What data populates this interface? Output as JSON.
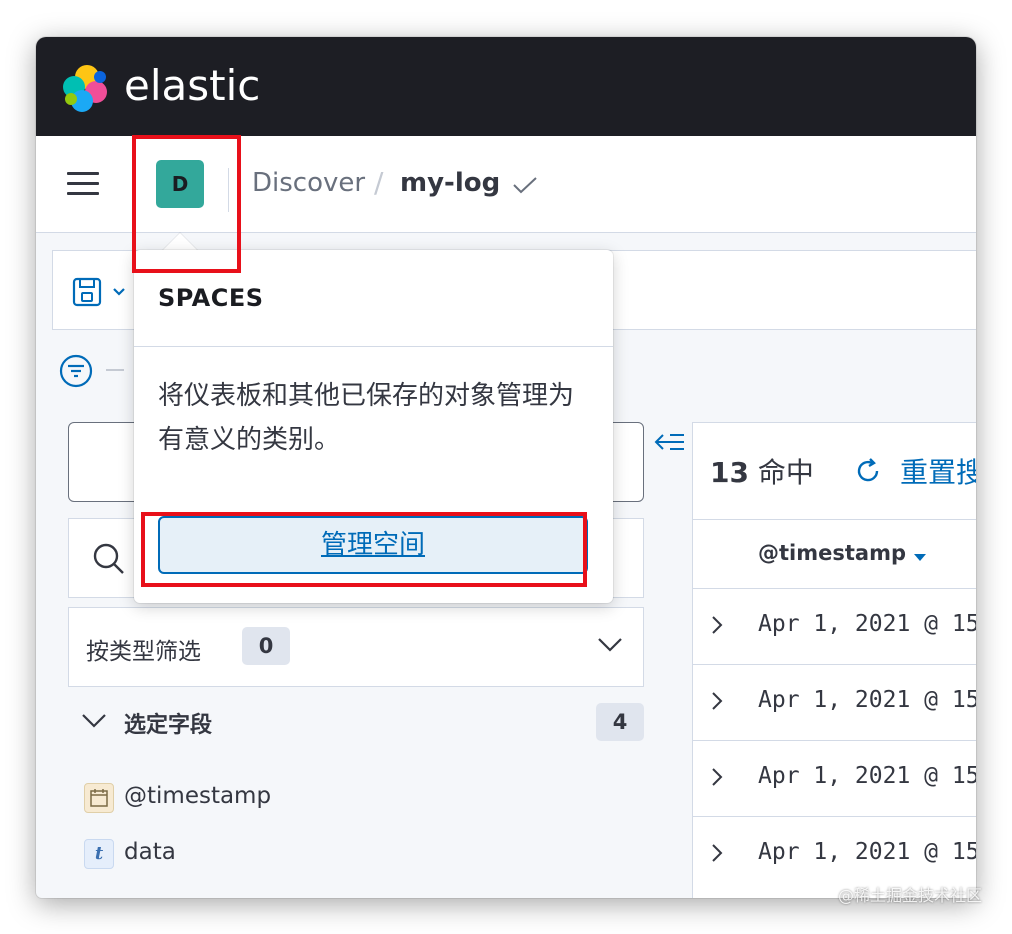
{
  "app": {
    "brand": "elastic"
  },
  "header": {
    "space_initial": "D",
    "breadcrumb_root": "Discover",
    "breadcrumb_separator": "/",
    "breadcrumb_current": "my-log"
  },
  "popover": {
    "title": "SPACES",
    "description": "将仪表板和其他已保存的对象管理为有意义的类别。",
    "manage_button": "管理空间"
  },
  "sidebar": {
    "type_filter_label": "按类型筛选",
    "type_filter_count": "0",
    "selected_fields_label": "选定字段",
    "selected_fields_count": "4",
    "fields": [
      {
        "name": "@timestamp",
        "type": "date"
      },
      {
        "name": "data",
        "type": "t"
      }
    ]
  },
  "results": {
    "hits_number": "13",
    "hits_label": "命中",
    "reset_label": "重置搜",
    "column_header": "@timestamp",
    "rows": [
      "Apr 1, 2021 @ 15",
      "Apr 1, 2021 @ 15",
      "Apr 1, 2021 @ 15",
      "Apr 1, 2021 @ 15"
    ]
  },
  "watermark": "@稀土掘金技术社区",
  "colors": {
    "topbar": "#1d1e24",
    "space_avatar": "#33a89b",
    "link": "#006bb8",
    "highlight": "#e8101a"
  }
}
